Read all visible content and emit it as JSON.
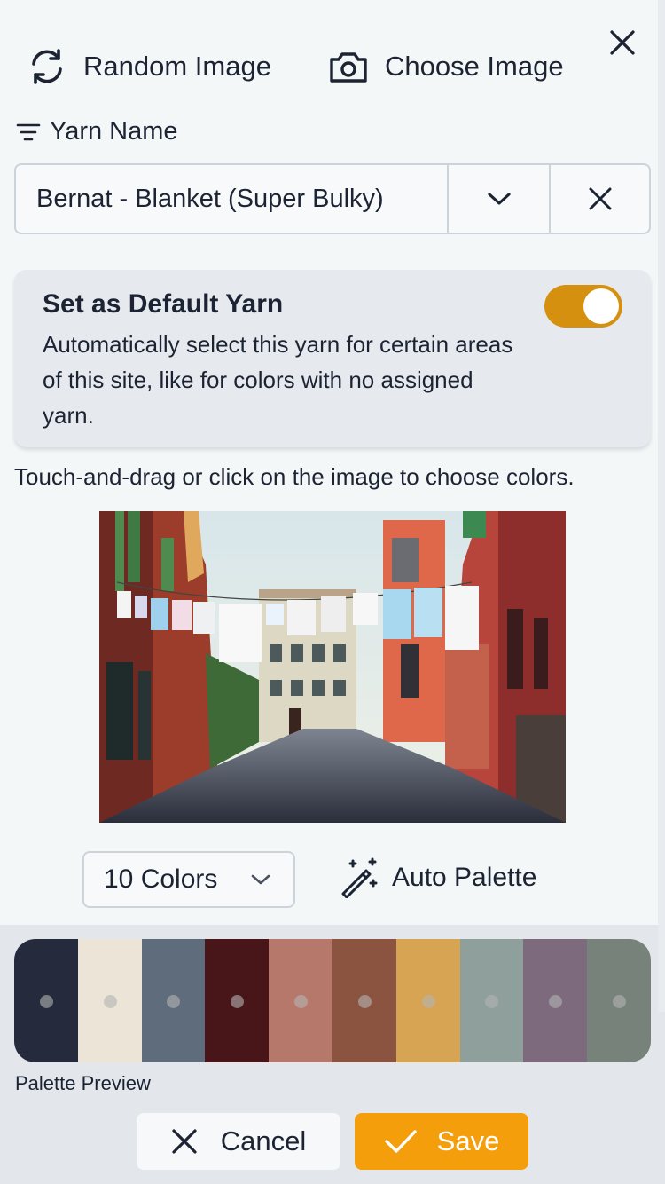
{
  "header": {
    "random_image_label": "Random Image",
    "choose_image_label": "Choose Image"
  },
  "yarn": {
    "label": "Yarn Name",
    "selected": "Bernat - Blanket (Super Bulky)"
  },
  "default_yarn": {
    "title": "Set as Default Yarn",
    "description": "Automatically select this yarn for certain areas of this site, like for colors with no assigned yarn.",
    "enabled": true
  },
  "hint": "Touch-and-drag or click on the image to choose colors.",
  "colors_select": {
    "value": "10 Colors"
  },
  "auto_palette_label": "Auto Palette",
  "palette": {
    "label": "Palette Preview",
    "swatches": [
      "#252b3d",
      "#ece4d6",
      "#5f6c7b",
      "#481618",
      "#b7786c",
      "#8b5440",
      "#d6a453",
      "#8f9f9c",
      "#7e6a7d",
      "#77837a"
    ]
  },
  "footer": {
    "cancel_label": "Cancel",
    "save_label": "Save"
  },
  "accent_colors": {
    "toggle": "#d4900e",
    "save": "#f59e0b"
  }
}
